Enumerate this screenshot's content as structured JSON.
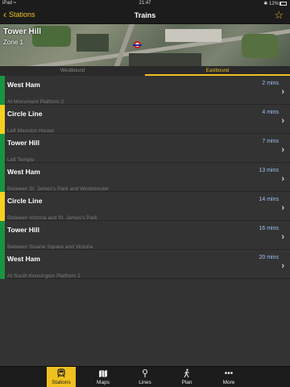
{
  "status_bar": {
    "carrier": "iPad",
    "time": "21:47",
    "battery": "12%"
  },
  "nav": {
    "back_label": "Stations",
    "title": "Trains"
  },
  "station": {
    "name": "Tower Hill",
    "zone": "Zone 1"
  },
  "directions": {
    "west": "Westbound",
    "east": "Eastbound",
    "selected": "Eastbound"
  },
  "trains": [
    {
      "destination": "West Ham",
      "time": "2 mins",
      "location": "At Monument Platform 2",
      "line_color": "#1a9440"
    },
    {
      "destination": "Circle Line",
      "time": "4 mins",
      "location": "Left Mansion House",
      "line_color": "#f5d020"
    },
    {
      "destination": "Tower Hill",
      "time": "7 mins",
      "location": "Left Temple",
      "line_color": "#1a9440"
    },
    {
      "destination": "West Ham",
      "time": "13 mins",
      "location": "Between St. James's Park and Westminster",
      "line_color": "#1a9440"
    },
    {
      "destination": "Circle Line",
      "time": "14 mins",
      "location": "Between Victoria and St. James's Park",
      "line_color": "#f5d020"
    },
    {
      "destination": "Tower Hill",
      "time": "16 mins",
      "location": "Between Sloane Square and Victoria",
      "line_color": "#1a9440"
    },
    {
      "destination": "West Ham",
      "time": "20 mins",
      "location": "At South Kensington Platform 2",
      "line_color": "#1a9440"
    }
  ],
  "tabs": [
    {
      "label": "Stations",
      "icon": "train-icon",
      "active": true
    },
    {
      "label": "Maps",
      "icon": "map-icon",
      "active": false
    },
    {
      "label": "Lines",
      "icon": "lines-icon",
      "active": false
    },
    {
      "label": "Plan",
      "icon": "walker-icon",
      "active": false
    },
    {
      "label": "More",
      "icon": "more-icon",
      "active": false
    }
  ],
  "colors": {
    "accent": "#f0c020",
    "district": "#1a9440",
    "circle": "#f5d020",
    "time_text": "#9fc3ef"
  }
}
